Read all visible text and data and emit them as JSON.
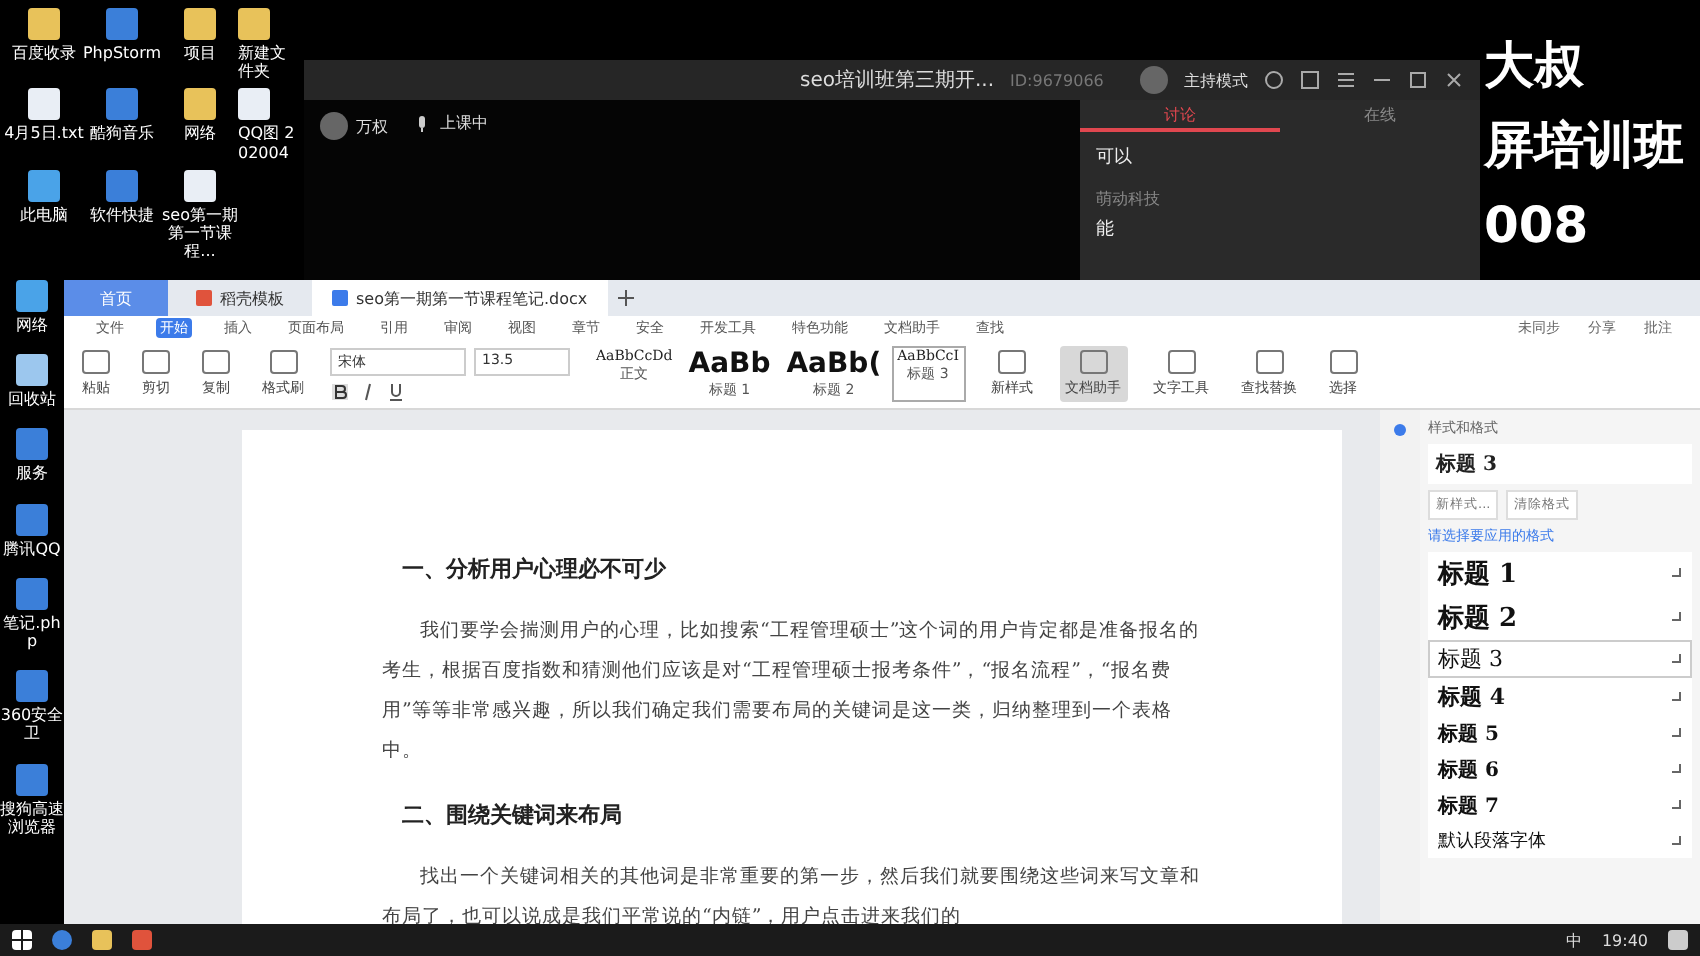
{
  "desktop_icons": [
    {
      "label": "百度收录",
      "kind": "folder"
    },
    {
      "label": "PhpStorm",
      "kind": "app"
    },
    {
      "label": "项目",
      "kind": "folder"
    },
    {
      "label": "新建文件夹",
      "kind": "folder"
    },
    {
      "label": "4月5日.txt",
      "kind": "file"
    },
    {
      "label": "酷狗音乐",
      "kind": "app"
    },
    {
      "label": "网络",
      "kind": "folder"
    },
    {
      "label": "QQ图 202004",
      "kind": "file"
    },
    {
      "label": "此电脑",
      "kind": "computer"
    },
    {
      "label": "软件快捷",
      "kind": "app"
    },
    {
      "label": "seo第一期第一节课程...",
      "kind": "file"
    },
    {
      "label": "网络",
      "kind": "computer"
    },
    {
      "label": "回收站",
      "kind": "recycle"
    },
    {
      "label": "服务",
      "kind": "app"
    },
    {
      "label": "腾讯QQ",
      "kind": "app"
    },
    {
      "label": "笔记.php",
      "kind": "app"
    },
    {
      "label": "360安全卫",
      "kind": "app"
    },
    {
      "label": "搜狗高速浏览器",
      "kind": "app"
    }
  ],
  "banner": [
    "大叔",
    "屏培训班",
    "008"
  ],
  "meeting": {
    "title": "seo培训班第三期开...",
    "id": "ID:9679066",
    "mode": "主持模式",
    "host": "万权",
    "status": "上课中",
    "tabs": [
      {
        "label": "讨论",
        "selected": true
      },
      {
        "label": "在线",
        "selected": false
      }
    ],
    "messages": [
      {
        "text": "可以"
      },
      {
        "author": "萌动科技",
        "text": "能"
      }
    ]
  },
  "wps": {
    "tabs": [
      {
        "label": "首页",
        "kind": "home",
        "selected": false
      },
      {
        "label": "稻壳模板",
        "kind": "app",
        "selected": false
      },
      {
        "label": "seo第一期第一节课程笔记.docx",
        "kind": "doc",
        "selected": true
      }
    ],
    "menu": [
      {
        "label": "文件",
        "selected": false
      },
      {
        "label": "开始",
        "selected": true
      },
      {
        "label": "插入",
        "selected": false
      },
      {
        "label": "页面布局",
        "selected": false
      },
      {
        "label": "引用",
        "selected": false
      },
      {
        "label": "审阅",
        "selected": false
      },
      {
        "label": "视图",
        "selected": false
      },
      {
        "label": "章节",
        "selected": false
      },
      {
        "label": "安全",
        "selected": false
      },
      {
        "label": "开发工具",
        "selected": false
      },
      {
        "label": "特色功能",
        "selected": false
      },
      {
        "label": "文档助手",
        "selected": false
      },
      {
        "label": "查找",
        "selected": false
      }
    ],
    "menu_right": [
      "未同步",
      "分享",
      "批注"
    ],
    "clipboard": [
      "粘贴",
      "剪切",
      "复制",
      "格式刷"
    ],
    "font": "宋体",
    "font_size": "13.5",
    "styles": [
      {
        "preview": "AaBbCcDd",
        "name": "正文",
        "selected": false
      },
      {
        "preview": "AaBb",
        "name": "标题 1",
        "selected": false
      },
      {
        "preview": "AaBb(",
        "name": "标题 2",
        "selected": false
      },
      {
        "preview": "AaBbCcI",
        "name": "标题 3",
        "selected": true
      }
    ],
    "tools": [
      {
        "label": "新样式",
        "selected": false
      },
      {
        "label": "文档助手",
        "selected": true
      },
      {
        "label": "文字工具",
        "selected": false
      },
      {
        "label": "查找替换",
        "selected": false
      },
      {
        "label": "选择",
        "selected": false
      }
    ],
    "document": [
      {
        "kind": "heading",
        "text": "一、分析用户心理必不可少"
      },
      {
        "kind": "paragraph",
        "text": "我们要学会揣测用户的心理，比如搜索“工程管理硕士”这个词的用户肯定都是准备报名的考生，根据百度指数和猜测他们应该是对“工程管理硕士报考条件”，“报名流程”，“报名费用”等等非常感兴趣，所以我们确定我们需要布局的关键词是这一类，归纳整理到一个表格中。"
      },
      {
        "kind": "heading",
        "text": "二、围绕关键词来布局"
      },
      {
        "kind": "paragraph",
        "text": "找出一个关键词相关的其他词是非常重要的第一步，然后我们就要围绕这些词来写文章和布局了，也可以说成是我们平常说的“内链”，用户点击进来我们的"
      }
    ],
    "pane": {
      "title": "样式和格式",
      "current": "标题 3",
      "buttons": [
        "新样式...",
        "清除格式"
      ],
      "prompt": "请选择要应用的格式",
      "items": [
        {
          "label": "标题 1",
          "kind": "h1",
          "selected": false
        },
        {
          "label": "标题 2",
          "kind": "h2",
          "selected": false
        },
        {
          "label": "标题 3",
          "kind": "h3",
          "selected": true
        },
        {
          "label": "标题 4",
          "kind": "h4",
          "selected": false
        },
        {
          "label": "标题 5",
          "kind": "h5",
          "selected": false
        },
        {
          "label": "标题 6",
          "kind": "h6",
          "selected": false
        },
        {
          "label": "标题 7",
          "kind": "h7",
          "selected": false
        },
        {
          "label": "默认段落字体",
          "kind": "plain",
          "selected": false
        }
      ]
    }
  },
  "taskbar": {
    "ime": "中",
    "time": "19:40"
  }
}
